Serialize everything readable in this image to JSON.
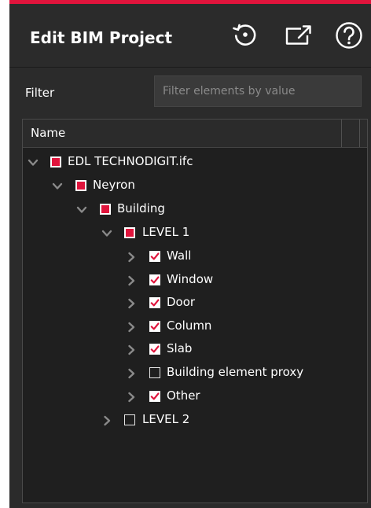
{
  "header": {
    "title": "Edit BIM Project",
    "icons": [
      "reset-icon",
      "open-external-icon",
      "help-icon"
    ],
    "accent_color": "#e0143c"
  },
  "filter": {
    "label": "Filter",
    "placeholder": "Filter elements by value",
    "value": ""
  },
  "tree": {
    "columns": [
      "Name"
    ],
    "nodes": [
      {
        "label": "EDL TECHNODIGIT.ifc",
        "state": "indeterminate",
        "expanded": true
      },
      {
        "label": "Neyron",
        "state": "indeterminate",
        "expanded": true
      },
      {
        "label": "Building",
        "state": "indeterminate",
        "expanded": true
      },
      {
        "label": "LEVEL 1",
        "state": "indeterminate",
        "expanded": true
      },
      {
        "label": "Wall",
        "state": "checked",
        "expanded": false
      },
      {
        "label": "Window",
        "state": "checked",
        "expanded": false
      },
      {
        "label": "Door",
        "state": "checked",
        "expanded": false
      },
      {
        "label": "Column",
        "state": "checked",
        "expanded": false
      },
      {
        "label": "Slab",
        "state": "checked",
        "expanded": false
      },
      {
        "label": "Building element proxy",
        "state": "unchecked",
        "expanded": false
      },
      {
        "label": "Other",
        "state": "checked",
        "expanded": false
      },
      {
        "label": "LEVEL 2",
        "state": "unchecked",
        "expanded": false
      }
    ]
  }
}
